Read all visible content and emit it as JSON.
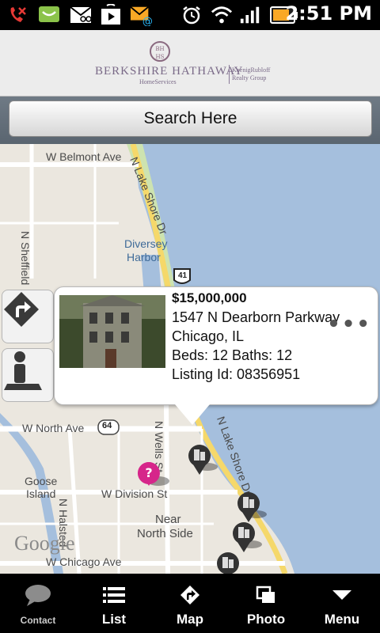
{
  "status_bar": {
    "time": "2:51 PM",
    "icons": [
      "missed-call-icon",
      "android-notification-icon",
      "voicemail-icon",
      "play-store-icon",
      "email-icon",
      "alarm-icon",
      "wifi-icon",
      "signal-icon",
      "battery-icon"
    ]
  },
  "header": {
    "logo_seal_text": "BH HS",
    "logo_main": "BERKSHIRE HATHAWAY",
    "logo_sub": "HomeServices",
    "logo_right_line1": "KoenigRubloff",
    "logo_right_line2": "Realty Group"
  },
  "search": {
    "label": "Search Here"
  },
  "map": {
    "streets": {
      "belmont": "W Belmont Ave",
      "lake_shore_top": "N Lake Shore Dr",
      "sheffield": "N Sheffield",
      "diversey_1": "Diversey",
      "diversey_2": "Harbor",
      "route_41": "41",
      "north_ave": "W North Ave",
      "route_64": "64",
      "wells": "N Wells St",
      "division": "W Division St",
      "goose_1": "Goose",
      "goose_2": "Island",
      "near_1": "Near",
      "near_2": "North Side",
      "halsted": "N Halsted",
      "chicago_ave": "W Chicago Ave",
      "lake_shore_bottom": "N Lake Shore Dr",
      "google": "Google"
    }
  },
  "popup": {
    "price": "$15,000,000",
    "address": "1547 N Dearborn Parkway",
    "city": "Chicago, IL",
    "beds_baths": "Beds: 12 Baths: 12",
    "listing_id": "Listing Id: 08356951",
    "more": "•••"
  },
  "bottom_nav": {
    "contact": "Contact",
    "list": "List",
    "map": "Map",
    "photo": "Photo",
    "menu": "Menu"
  },
  "colors": {
    "water": "#a5bfdd",
    "land": "#ebe7df",
    "park": "#cde3b0",
    "highway": "#f5d86a",
    "marker_pink": "#d6268a",
    "marker_dark": "#333333"
  }
}
